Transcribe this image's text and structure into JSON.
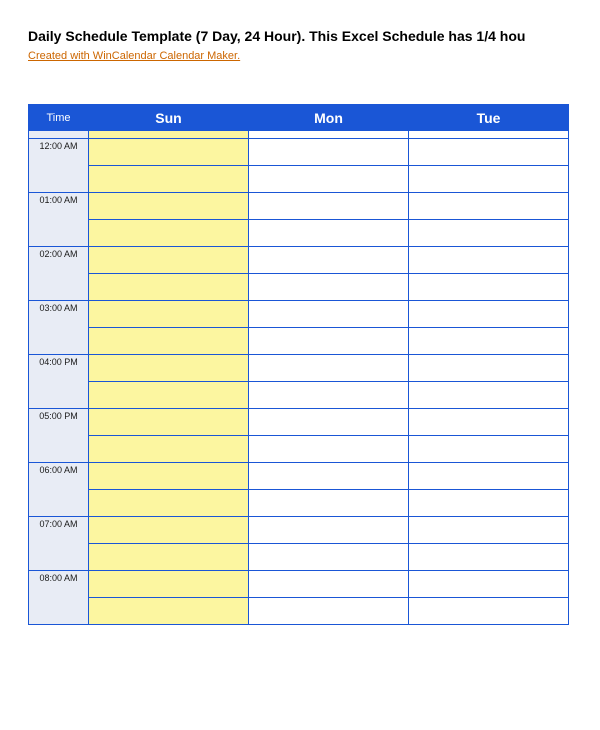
{
  "header": {
    "title": "Daily Schedule Template (7 Day, 24 Hour).  This Excel Schedule has 1/4 hou",
    "subtitle_link": "Created with WinCalendar Calendar Maker."
  },
  "table": {
    "time_header": "Time",
    "days": [
      "Sun",
      "Mon",
      "Tue"
    ],
    "hours": [
      "12:00 AM",
      "01:00 AM",
      "02:00 AM",
      "03:00 AM",
      "04:00 PM",
      "05:00 PM",
      "06:00 AM",
      "07:00 AM",
      "08:00 AM"
    ]
  }
}
